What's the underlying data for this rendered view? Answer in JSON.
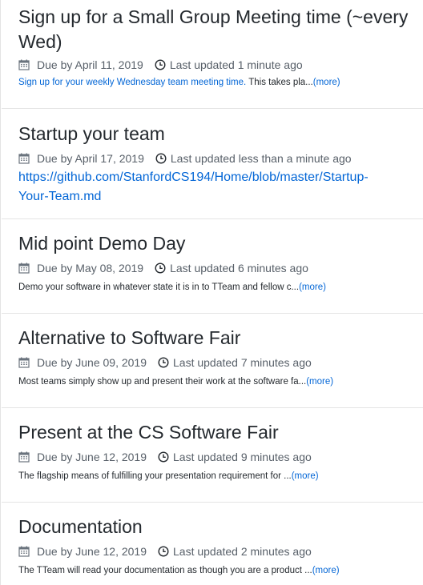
{
  "assignments": [
    {
      "title": "Sign up for a Small Group Meeting time (~every Wed)",
      "due": "Due by April 11, 2019",
      "updated": "Last updated 1 minute ago",
      "desc_link": "Sign up for your weekly Wednesday team meeting time.",
      "desc_text": " This takes pla...",
      "more": "(more)"
    },
    {
      "title": "Startup your team",
      "due": "Due by April 17, 2019",
      "updated": "Last updated less than a minute ago",
      "url_line1": "https://github.com/StanfordCS194/Home/blob/master/Startup-",
      "url_line2": "Your-Team.md"
    },
    {
      "title": "Mid point Demo Day",
      "due": "Due by May 08, 2019",
      "updated": "Last updated 6 minutes ago",
      "desc_text": "Demo your software in whatever state it is in to TTeam and fellow c...",
      "more": "(more)"
    },
    {
      "title": "Alternative to Software Fair",
      "due": "Due by June 09, 2019",
      "updated": "Last updated 7 minutes ago",
      "desc_text": "Most teams simply show up and present their work at the software fa...",
      "more": "(more)"
    },
    {
      "title": "Present at the CS Software Fair",
      "due": "Due by June 12, 2019",
      "updated": "Last updated 9 minutes ago",
      "desc_text": "The flagship means of fulfilling your presentation requirement for ...",
      "more": "(more)"
    },
    {
      "title": "Documentation",
      "due": "Due by June 12, 2019",
      "updated": "Last updated 2 minutes ago",
      "desc_text": "The TTeam will read your documentation as though you are a product ...",
      "more": "(more)"
    }
  ]
}
